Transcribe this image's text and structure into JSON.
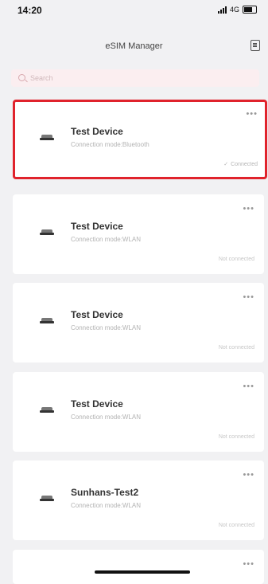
{
  "status": {
    "time": "14:20",
    "network": "4G"
  },
  "nav": {
    "title": "eSIM Manager",
    "action_icon": "document-icon"
  },
  "search": {
    "placeholder": "Search",
    "value": ""
  },
  "accent": "#e0232c",
  "devices": [
    {
      "name": "Test Device",
      "mode": "Connection mode:Bluetooth",
      "status": "Connected",
      "selected": true
    },
    {
      "name": "Test Device",
      "mode": "Connection mode:WLAN",
      "status": "Not connected",
      "selected": false
    },
    {
      "name": "Test Device",
      "mode": "Connection mode:WLAN",
      "status": "Not connected",
      "selected": false
    },
    {
      "name": "Test Device",
      "mode": "Connection mode:WLAN",
      "status": "Not connected",
      "selected": false
    },
    {
      "name": "Sunhans-Test2",
      "mode": "Connection mode:WLAN",
      "status": "Not connected",
      "selected": false
    }
  ],
  "more_label": "•••"
}
